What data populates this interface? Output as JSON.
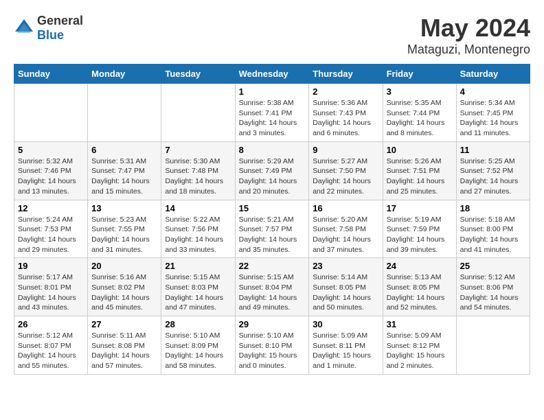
{
  "logo": {
    "text_general": "General",
    "text_blue": "Blue"
  },
  "header": {
    "month": "May 2024",
    "location": "Mataguzi, Montenegro"
  },
  "weekdays": [
    "Sunday",
    "Monday",
    "Tuesday",
    "Wednesday",
    "Thursday",
    "Friday",
    "Saturday"
  ],
  "weeks": [
    [
      {
        "day": "",
        "sunrise": "",
        "sunset": "",
        "daylight": ""
      },
      {
        "day": "",
        "sunrise": "",
        "sunset": "",
        "daylight": ""
      },
      {
        "day": "",
        "sunrise": "",
        "sunset": "",
        "daylight": ""
      },
      {
        "day": "1",
        "sunrise": "Sunrise: 5:38 AM",
        "sunset": "Sunset: 7:41 PM",
        "daylight": "Daylight: 14 hours and 3 minutes."
      },
      {
        "day": "2",
        "sunrise": "Sunrise: 5:36 AM",
        "sunset": "Sunset: 7:43 PM",
        "daylight": "Daylight: 14 hours and 6 minutes."
      },
      {
        "day": "3",
        "sunrise": "Sunrise: 5:35 AM",
        "sunset": "Sunset: 7:44 PM",
        "daylight": "Daylight: 14 hours and 8 minutes."
      },
      {
        "day": "4",
        "sunrise": "Sunrise: 5:34 AM",
        "sunset": "Sunset: 7:45 PM",
        "daylight": "Daylight: 14 hours and 11 minutes."
      }
    ],
    [
      {
        "day": "5",
        "sunrise": "Sunrise: 5:32 AM",
        "sunset": "Sunset: 7:46 PM",
        "daylight": "Daylight: 14 hours and 13 minutes."
      },
      {
        "day": "6",
        "sunrise": "Sunrise: 5:31 AM",
        "sunset": "Sunset: 7:47 PM",
        "daylight": "Daylight: 14 hours and 15 minutes."
      },
      {
        "day": "7",
        "sunrise": "Sunrise: 5:30 AM",
        "sunset": "Sunset: 7:48 PM",
        "daylight": "Daylight: 14 hours and 18 minutes."
      },
      {
        "day": "8",
        "sunrise": "Sunrise: 5:29 AM",
        "sunset": "Sunset: 7:49 PM",
        "daylight": "Daylight: 14 hours and 20 minutes."
      },
      {
        "day": "9",
        "sunrise": "Sunrise: 5:27 AM",
        "sunset": "Sunset: 7:50 PM",
        "daylight": "Daylight: 14 hours and 22 minutes."
      },
      {
        "day": "10",
        "sunrise": "Sunrise: 5:26 AM",
        "sunset": "Sunset: 7:51 PM",
        "daylight": "Daylight: 14 hours and 25 minutes."
      },
      {
        "day": "11",
        "sunrise": "Sunrise: 5:25 AM",
        "sunset": "Sunset: 7:52 PM",
        "daylight": "Daylight: 14 hours and 27 minutes."
      }
    ],
    [
      {
        "day": "12",
        "sunrise": "Sunrise: 5:24 AM",
        "sunset": "Sunset: 7:53 PM",
        "daylight": "Daylight: 14 hours and 29 minutes."
      },
      {
        "day": "13",
        "sunrise": "Sunrise: 5:23 AM",
        "sunset": "Sunset: 7:55 PM",
        "daylight": "Daylight: 14 hours and 31 minutes."
      },
      {
        "day": "14",
        "sunrise": "Sunrise: 5:22 AM",
        "sunset": "Sunset: 7:56 PM",
        "daylight": "Daylight: 14 hours and 33 minutes."
      },
      {
        "day": "15",
        "sunrise": "Sunrise: 5:21 AM",
        "sunset": "Sunset: 7:57 PM",
        "daylight": "Daylight: 14 hours and 35 minutes."
      },
      {
        "day": "16",
        "sunrise": "Sunrise: 5:20 AM",
        "sunset": "Sunset: 7:58 PM",
        "daylight": "Daylight: 14 hours and 37 minutes."
      },
      {
        "day": "17",
        "sunrise": "Sunrise: 5:19 AM",
        "sunset": "Sunset: 7:59 PM",
        "daylight": "Daylight: 14 hours and 39 minutes."
      },
      {
        "day": "18",
        "sunrise": "Sunrise: 5:18 AM",
        "sunset": "Sunset: 8:00 PM",
        "daylight": "Daylight: 14 hours and 41 minutes."
      }
    ],
    [
      {
        "day": "19",
        "sunrise": "Sunrise: 5:17 AM",
        "sunset": "Sunset: 8:01 PM",
        "daylight": "Daylight: 14 hours and 43 minutes."
      },
      {
        "day": "20",
        "sunrise": "Sunrise: 5:16 AM",
        "sunset": "Sunset: 8:02 PM",
        "daylight": "Daylight: 14 hours and 45 minutes."
      },
      {
        "day": "21",
        "sunrise": "Sunrise: 5:15 AM",
        "sunset": "Sunset: 8:03 PM",
        "daylight": "Daylight: 14 hours and 47 minutes."
      },
      {
        "day": "22",
        "sunrise": "Sunrise: 5:15 AM",
        "sunset": "Sunset: 8:04 PM",
        "daylight": "Daylight: 14 hours and 49 minutes."
      },
      {
        "day": "23",
        "sunrise": "Sunrise: 5:14 AM",
        "sunset": "Sunset: 8:05 PM",
        "daylight": "Daylight: 14 hours and 50 minutes."
      },
      {
        "day": "24",
        "sunrise": "Sunrise: 5:13 AM",
        "sunset": "Sunset: 8:05 PM",
        "daylight": "Daylight: 14 hours and 52 minutes."
      },
      {
        "day": "25",
        "sunrise": "Sunrise: 5:12 AM",
        "sunset": "Sunset: 8:06 PM",
        "daylight": "Daylight: 14 hours and 54 minutes."
      }
    ],
    [
      {
        "day": "26",
        "sunrise": "Sunrise: 5:12 AM",
        "sunset": "Sunset: 8:07 PM",
        "daylight": "Daylight: 14 hours and 55 minutes."
      },
      {
        "day": "27",
        "sunrise": "Sunrise: 5:11 AM",
        "sunset": "Sunset: 8:08 PM",
        "daylight": "Daylight: 14 hours and 57 minutes."
      },
      {
        "day": "28",
        "sunrise": "Sunrise: 5:10 AM",
        "sunset": "Sunset: 8:09 PM",
        "daylight": "Daylight: 14 hours and 58 minutes."
      },
      {
        "day": "29",
        "sunrise": "Sunrise: 5:10 AM",
        "sunset": "Sunset: 8:10 PM",
        "daylight": "Daylight: 15 hours and 0 minutes."
      },
      {
        "day": "30",
        "sunrise": "Sunrise: 5:09 AM",
        "sunset": "Sunset: 8:11 PM",
        "daylight": "Daylight: 15 hours and 1 minute."
      },
      {
        "day": "31",
        "sunrise": "Sunrise: 5:09 AM",
        "sunset": "Sunset: 8:12 PM",
        "daylight": "Daylight: 15 hours and 2 minutes."
      },
      {
        "day": "",
        "sunrise": "",
        "sunset": "",
        "daylight": ""
      }
    ]
  ]
}
